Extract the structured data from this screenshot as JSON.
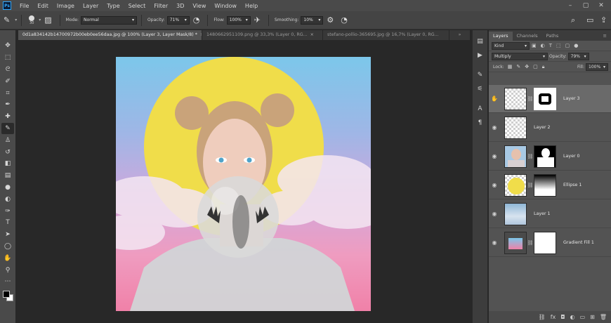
{
  "menubar": {
    "logo": "Ps",
    "items": [
      "File",
      "Edit",
      "Image",
      "Layer",
      "Type",
      "Select",
      "Filter",
      "3D",
      "View",
      "Window",
      "Help"
    ],
    "icons": [
      "search-icon",
      "workspace-icon",
      "share-icon"
    ]
  },
  "options": {
    "brush_size": "30",
    "mode_label": "Mode:",
    "mode_value": "Normal",
    "opacity_label": "Opacity:",
    "opacity_value": "71%",
    "flow_label": "Flow:",
    "flow_value": "100%",
    "smoothing_label": "Smoothing:",
    "smoothing_value": "10%"
  },
  "tabs": [
    {
      "label": "0d1a834142b14700972b00eb0ee56daa.jpg @ 100% (Layer 3, Layer Mask/8) *",
      "close": "×"
    },
    {
      "label": "1480662951109.png @ 33,3% (Layer 0, RG...",
      "close": "×"
    },
    {
      "label": "stefano-pollio-365695.jpg @ 16,7% (Layer 0, RG...",
      "close": ""
    }
  ],
  "tools": [
    "move-icon",
    "marquee-icon",
    "lasso-icon",
    "quick-select-icon",
    "crop-icon",
    "eyedropper-icon",
    "healing-icon",
    "brush-icon",
    "stamp-icon",
    "history-brush-icon",
    "eraser-icon",
    "gradient-icon",
    "blur-icon",
    "dodge-icon",
    "pen-icon",
    "type-icon",
    "path-select-icon",
    "shape-icon",
    "hand-icon",
    "zoom-icon",
    "more-icon"
  ],
  "layers_panel": {
    "tabs": [
      "Layers",
      "Channels",
      "Paths"
    ],
    "filter_kind": "Kind",
    "blend_mode": "Multiply",
    "opacity_label": "Opacity:",
    "opacity_value": "79%",
    "lock_label": "Lock:",
    "fill_label": "Fill:",
    "fill_value": "100%",
    "layers": [
      {
        "name": "Layer 3",
        "selected": true,
        "has_mask": true
      },
      {
        "name": "Layer 2",
        "selected": false,
        "has_mask": false
      },
      {
        "name": "Layer 0",
        "selected": false,
        "has_mask": true
      },
      {
        "name": "Ellipse 1",
        "selected": false,
        "has_mask": true
      },
      {
        "name": "Layer 1",
        "selected": false,
        "has_mask": false
      },
      {
        "name": "Gradient Fill 1",
        "selected": false,
        "has_mask": true
      }
    ]
  },
  "colors": {
    "accent": "#31a8ff",
    "panel_bg": "#535353",
    "selected_layer": "#6a6a6a",
    "sun": "#f0dd4a"
  }
}
